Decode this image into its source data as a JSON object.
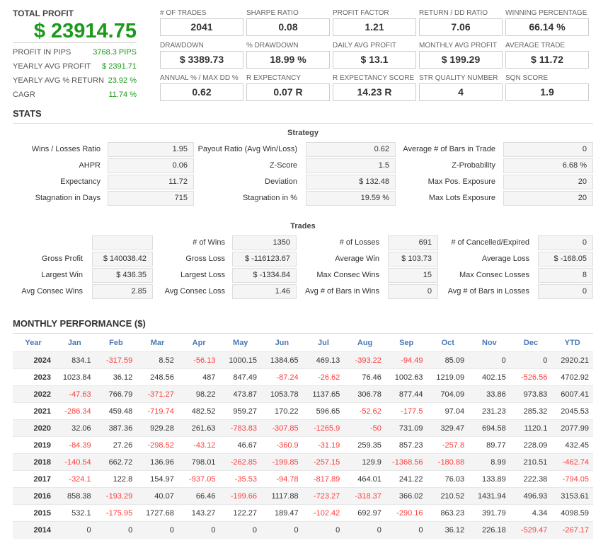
{
  "total_profit": {
    "title": "TOTAL PROFIT",
    "value": "$ 23914.75",
    "rows": [
      {
        "label": "PROFIT IN PIPS",
        "value": "3768.3 PIPS"
      },
      {
        "label": "YEARLY AVG PROFIT",
        "value": "$ 2391.71"
      },
      {
        "label": "YEARLY AVG % RETURN",
        "value": "23.92 %"
      },
      {
        "label": "CAGR",
        "value": "11.74 %"
      }
    ]
  },
  "metrics": [
    {
      "label": "# OF TRADES",
      "value": "2041"
    },
    {
      "label": "SHARPE RATIO",
      "value": "0.08"
    },
    {
      "label": "PROFIT FACTOR",
      "value": "1.21"
    },
    {
      "label": "RETURN / DD RATIO",
      "value": "7.06"
    },
    {
      "label": "WINNING PERCENTAGE",
      "value": "66.14 %"
    },
    {
      "label": "DRAWDOWN",
      "value": "$ 3389.73"
    },
    {
      "label": "% DRAWDOWN",
      "value": "18.99 %"
    },
    {
      "label": "DAILY AVG PROFIT",
      "value": "$ 13.1"
    },
    {
      "label": "MONTHLY AVG PROFIT",
      "value": "$ 199.29"
    },
    {
      "label": "AVERAGE TRADE",
      "value": "$ 11.72"
    },
    {
      "label": "ANNUAL % / MAX DD %",
      "value": "0.62"
    },
    {
      "label": "R EXPECTANCY",
      "value": "0.07 R"
    },
    {
      "label": "R EXPECTANCY SCORE",
      "value": "14.23 R"
    },
    {
      "label": "STR QUALITY NUMBER",
      "value": "4"
    },
    {
      "label": "SQN SCORE",
      "value": "1.9"
    }
  ],
  "stats": {
    "title": "STATS",
    "strategy": {
      "title": "Strategy",
      "rows": [
        [
          {
            "label": "Wins / Losses Ratio",
            "value": "1.95"
          },
          {
            "label": "Payout Ratio (Avg Win/Loss)",
            "value": "0.62"
          },
          {
            "label": "Average # of Bars in Trade",
            "value": "0"
          }
        ],
        [
          {
            "label": "AHPR",
            "value": "0.06"
          },
          {
            "label": "Z-Score",
            "value": "1.5"
          },
          {
            "label": "Z-Probability",
            "value": "6.68 %"
          }
        ],
        [
          {
            "label": "Expectancy",
            "value": "11.72"
          },
          {
            "label": "Deviation",
            "value": "$ 132.48"
          },
          {
            "label": "Max Pos. Exposure",
            "value": "20"
          }
        ],
        [
          {
            "label": "Stagnation in Days",
            "value": "715"
          },
          {
            "label": "Stagnation in %",
            "value": "19.59 %"
          },
          {
            "label": "Max Lots Exposure",
            "value": "20"
          }
        ]
      ]
    },
    "trades": {
      "title": "Trades",
      "rows": [
        [
          {
            "label": "",
            "value": ""
          },
          {
            "label": "# of Wins",
            "value": "1350"
          },
          {
            "label": "# of Losses",
            "value": "691"
          },
          {
            "label": "# of Cancelled/Expired",
            "value": "0"
          }
        ],
        [
          {
            "label": "Gross Profit",
            "value": "$ 140038.42"
          },
          {
            "label": "Gross Loss",
            "value": "$ -116123.67"
          },
          {
            "label": "Average Win",
            "value": "$ 103.73"
          },
          {
            "label": "Average Loss",
            "value": "$ -168.05"
          }
        ],
        [
          {
            "label": "Largest Win",
            "value": "$ 436.35"
          },
          {
            "label": "Largest Loss",
            "value": "$ -1334.84"
          },
          {
            "label": "Max Consec Wins",
            "value": "15"
          },
          {
            "label": "Max Consec Losses",
            "value": "8"
          }
        ],
        [
          {
            "label": "Avg Consec Wins",
            "value": "2.85"
          },
          {
            "label": "Avg Consec Loss",
            "value": "1.46"
          },
          {
            "label": "Avg # of Bars in Wins",
            "value": "0"
          },
          {
            "label": "Avg # of Bars in Losses",
            "value": "0"
          }
        ]
      ]
    }
  },
  "monthly": {
    "title": "MONTHLY PERFORMANCE ($)",
    "headers": [
      "Year",
      "Jan",
      "Feb",
      "Mar",
      "Apr",
      "May",
      "Jun",
      "Jul",
      "Aug",
      "Sep",
      "Oct",
      "Nov",
      "Dec",
      "YTD"
    ],
    "rows": [
      [
        "2024",
        "834.1",
        "-317.59",
        "8.52",
        "-56.13",
        "1000.15",
        "1384.65",
        "469.13",
        "-393.22",
        "-94.49",
        "85.09",
        "0",
        "0",
        "2920.21"
      ],
      [
        "2023",
        "1023.84",
        "36.12",
        "248.56",
        "487",
        "847.49",
        "-87.24",
        "-26.62",
        "76.46",
        "1002.63",
        "1219.09",
        "402.15",
        "-526.56",
        "4702.92"
      ],
      [
        "2022",
        "-47.63",
        "766.79",
        "-371.27",
        "98.22",
        "473.87",
        "1053.78",
        "1137.65",
        "306.78",
        "877.44",
        "704.09",
        "33.86",
        "973.83",
        "6007.41"
      ],
      [
        "2021",
        "-286.34",
        "459.48",
        "-719.74",
        "482.52",
        "959.27",
        "170.22",
        "596.65",
        "-52.62",
        "-177.5",
        "97.04",
        "231.23",
        "285.32",
        "2045.53"
      ],
      [
        "2020",
        "32.06",
        "387.36",
        "929.28",
        "261.63",
        "-783.83",
        "-307.85",
        "-1265.9",
        "-50",
        "731.09",
        "329.47",
        "694.58",
        "1120.1",
        "2077.99"
      ],
      [
        "2019",
        "-84.39",
        "27.26",
        "-298.52",
        "-43.12",
        "46.67",
        "-360.9",
        "-31.19",
        "259.35",
        "857.23",
        "-257.8",
        "89.77",
        "228.09",
        "432.45"
      ],
      [
        "2018",
        "-140.54",
        "662.72",
        "136.96",
        "798.01",
        "-262.85",
        "-199.85",
        "-257.15",
        "129.9",
        "-1368.56",
        "-180.88",
        "8.99",
        "210.51",
        "-462.74"
      ],
      [
        "2017",
        "-324.1",
        "122.8",
        "154.97",
        "-937.05",
        "-35.53",
        "-94.78",
        "-817.89",
        "464.01",
        "241.22",
        "76.03",
        "133.89",
        "222.38",
        "-794.05"
      ],
      [
        "2016",
        "858.38",
        "-193.29",
        "40.07",
        "66.46",
        "-199.66",
        "1117.88",
        "-723.27",
        "-318.37",
        "366.02",
        "210.52",
        "1431.94",
        "496.93",
        "3153.61"
      ],
      [
        "2015",
        "532.1",
        "-175.95",
        "1727.68",
        "143.27",
        "122.27",
        "189.47",
        "-102.42",
        "692.97",
        "-290.16",
        "863.23",
        "391.79",
        "4.34",
        "4098.59"
      ],
      [
        "2014",
        "0",
        "0",
        "0",
        "0",
        "0",
        "0",
        "0",
        "0",
        "0",
        "36.12",
        "226.18",
        "-529.47",
        "-267.17"
      ]
    ]
  },
  "colors": {
    "positive": "#1a9a1a",
    "negative": "#ff3c3c",
    "header": "#4a78b5"
  }
}
